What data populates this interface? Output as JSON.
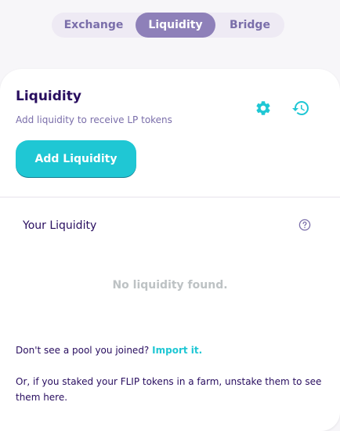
{
  "tabs": [
    "Exchange",
    "Liquidity",
    "Bridge"
  ],
  "active_tab": "Liquidity",
  "card": {
    "title": "Liquidity",
    "subtitle": "Add liquidity to receive LP tokens",
    "add_button": "Add Liquidity",
    "your_liquidity": "Your Liquidity",
    "empty_message": "No liquidity found.",
    "pool_prompt": "Don't see a pool you joined?",
    "import_link": "Import it.",
    "farm_note": "Or, if you staked your FLIP tokens in a farm, unstake them to see them here."
  },
  "icons": {
    "settings": "gear-icon",
    "history": "history-icon",
    "help": "question-circle-icon"
  },
  "colors": {
    "accent": "#1fc7d4",
    "primary_text": "#280d5f",
    "secondary_text": "#7a6eaa",
    "active_tab_bg": "#8e80b9"
  }
}
